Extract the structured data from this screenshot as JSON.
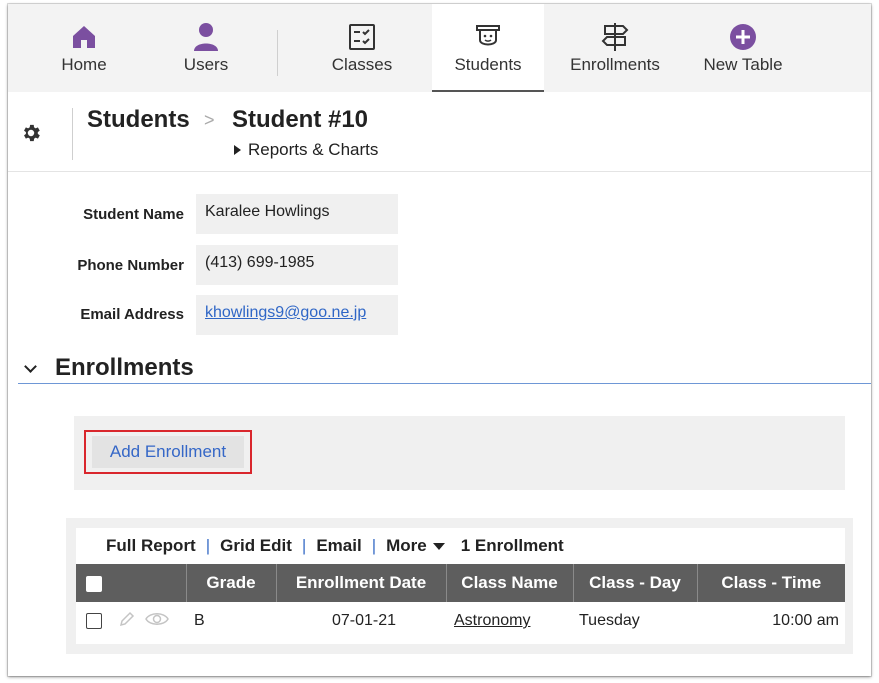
{
  "nav": {
    "items": [
      {
        "label": "Home",
        "icon": "home-icon"
      },
      {
        "label": "Users",
        "icon": "user-icon"
      },
      {
        "label": "Classes",
        "icon": "checklist-icon"
      },
      {
        "label": "Students",
        "icon": "student-icon"
      },
      {
        "label": "Enrollments",
        "icon": "signpost-icon"
      },
      {
        "label": "New Table",
        "icon": "plus-circle-icon"
      }
    ],
    "active": "Students",
    "accent": "#7b4fa0"
  },
  "breadcrumb": {
    "root": "Students",
    "separator": ">",
    "current": "Student #10",
    "sublink": "Reports & Charts"
  },
  "fields": {
    "student_name": {
      "label": "Student Name",
      "value": "Karalee Howlings"
    },
    "phone_number": {
      "label": "Phone Number",
      "value": "(413) 699-1985"
    },
    "email_address": {
      "label": "Email Address",
      "value": "khowlings9@goo.ne.jp"
    }
  },
  "enrollments": {
    "section_title": "Enrollments",
    "add_button": "Add Enrollment",
    "toolbar": {
      "full_report": "Full Report",
      "grid_edit": "Grid Edit",
      "email": "Email",
      "more": "More",
      "count": "1 Enrollment"
    },
    "columns": [
      "Grade",
      "Enrollment Date",
      "Class Name",
      "Class - Day",
      "Class - Time"
    ],
    "rows": [
      {
        "grade": "B",
        "enrollment_date": "07-01-21",
        "class_name": "Astronomy",
        "class_day": "Tuesday",
        "class_time": "10:00 am"
      }
    ]
  },
  "colors": {
    "link": "#2f66c6",
    "header_bg": "#5e5e5e",
    "highlight": "#d9262c"
  }
}
